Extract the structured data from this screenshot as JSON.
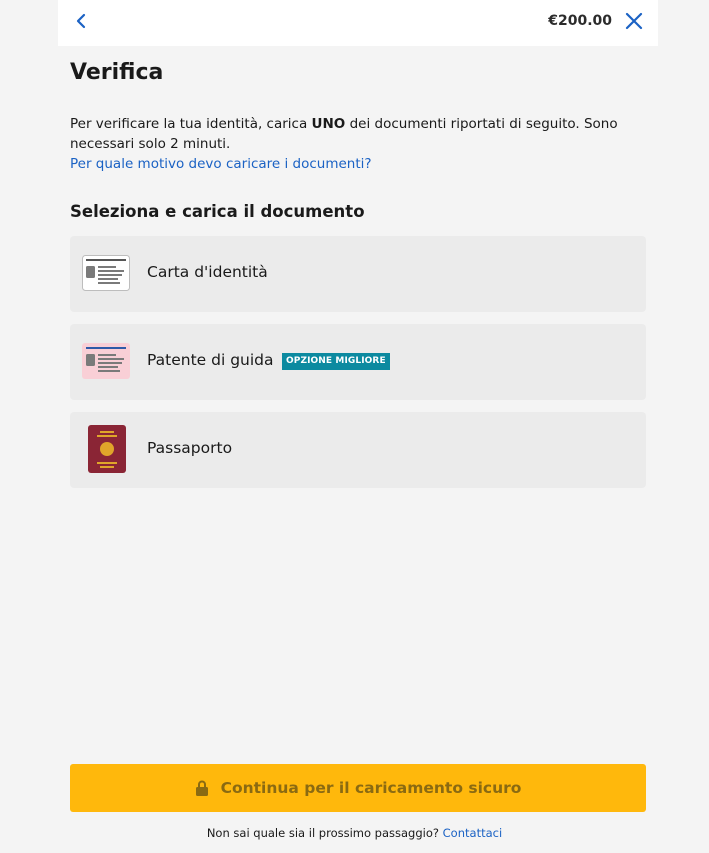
{
  "header": {
    "amount": "€200.00",
    "back_icon": "chevron-left-icon",
    "close_icon": "close-icon",
    "accent_color": "#1b62c4"
  },
  "page": {
    "title": "Verifica",
    "intro_before": "Per verificare la tua identità, carica ",
    "intro_bold": "UNO",
    "intro_after": " dei documenti riportati di seguito. Sono necessari solo 2 minuti.",
    "why_link": "Per quale motivo devo caricare i documenti?",
    "section_title": "Seleziona e carica il documento"
  },
  "documents": [
    {
      "label": "Carta d'identità",
      "icon": "id-card-icon"
    },
    {
      "label": "Patente di guida",
      "icon": "driving-license-icon",
      "badge": "OPZIONE MIGLIORE"
    },
    {
      "label": "Passaporto",
      "icon": "passport-icon"
    }
  ],
  "cta": {
    "label": "Continua per il caricamento sicuro",
    "icon": "lock-icon",
    "color": "#ffb80c"
  },
  "footer": {
    "text": "Non sai quale sia il prossimo passaggio?",
    "link": "Contattaci"
  },
  "badge_color": "#0c8aa0"
}
